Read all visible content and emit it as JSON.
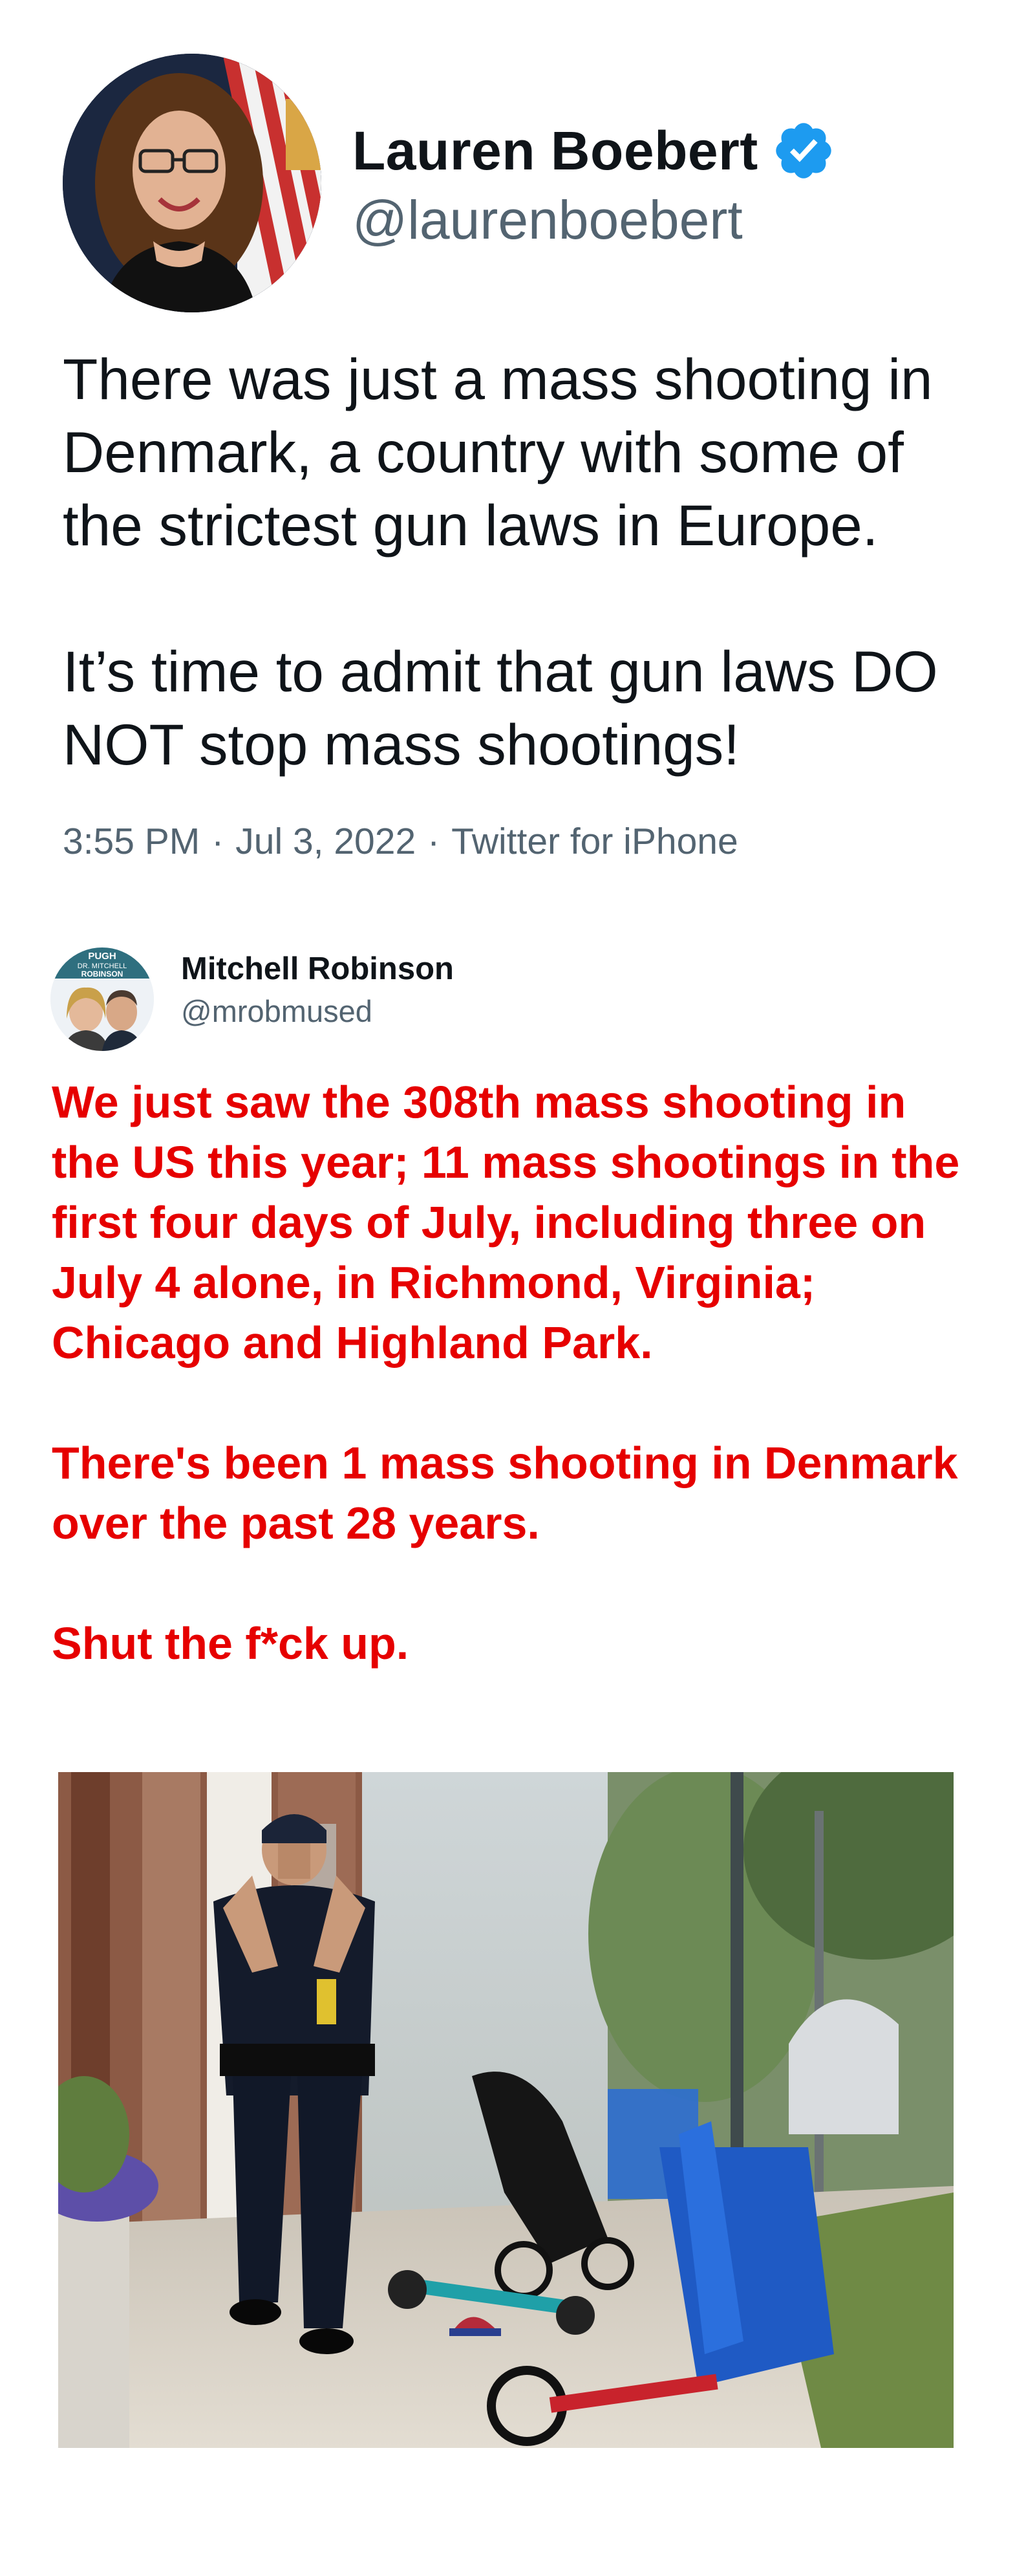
{
  "tweet": {
    "display_name": "Lauren Boebert",
    "handle": "@laurenboebert",
    "verified_icon": "verified-badge-icon",
    "body": [
      "There was just a mass shooting in Denmark, a country with some of the strictest gun laws in Europe.",
      "It’s time to admit that gun laws DO NOT stop mass shootings!"
    ],
    "time": "3:55 PM",
    "date": "Jul 3, 2022",
    "source": "Twitter for iPhone",
    "separator": "·"
  },
  "reply": {
    "avatar_text": [
      "PUGH",
      "DR. MITCHELL",
      "ROBINSON"
    ],
    "display_name": "Mitchell Robinson",
    "handle": "@mrobmused",
    "body": [
      "We just saw the 308th mass shooting in the US this year; 11 mass shootings in the first four days of July, including three on July 4 alone, in Richmond, Virginia; Chicago and Highland Park.",
      "There's been 1 mass shooting in Denmark over the past 28 years.",
      "Shut the f*ck up."
    ],
    "text_color": "#e60000"
  },
  "colors": {
    "verified_blue": "#1d9bf0",
    "primary_text": "#0f1419",
    "secondary_text": "#536471"
  }
}
